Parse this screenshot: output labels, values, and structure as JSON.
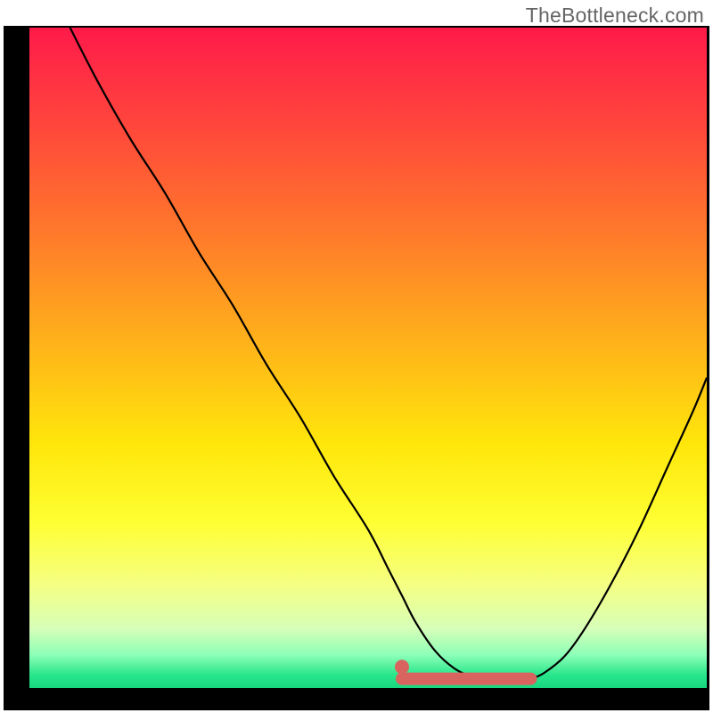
{
  "watermark": "TheBottleneck.com",
  "colors": {
    "curve_stroke": "#000000",
    "marker_stroke": "#d9645f",
    "marker_fill": "#d9645f",
    "frame_bg": "#000000"
  },
  "chart_data": {
    "type": "line",
    "title": "",
    "xlabel": "",
    "ylabel": "",
    "xlim": [
      0,
      100
    ],
    "ylim": [
      0,
      100
    ],
    "series": [
      {
        "name": "curve",
        "x": [
          6,
          10,
          15,
          20,
          25,
          30,
          35,
          40,
          45,
          50,
          53,
          55,
          57,
          60,
          63,
          66,
          69,
          72,
          74,
          76,
          79,
          82,
          86,
          90,
          94,
          98,
          100
        ],
        "y": [
          100,
          92,
          83,
          75,
          66,
          58,
          49,
          41,
          32,
          24,
          18,
          14,
          10,
          5.5,
          2.8,
          1.5,
          1.1,
          1.0,
          1.4,
          2.3,
          4.8,
          9,
          16,
          24,
          33,
          42,
          47
        ]
      }
    ],
    "flat_segment": {
      "x_start": 55,
      "x_end": 74,
      "y": 1.4
    },
    "marker_dot": {
      "x": 55,
      "y": 3.2
    }
  }
}
